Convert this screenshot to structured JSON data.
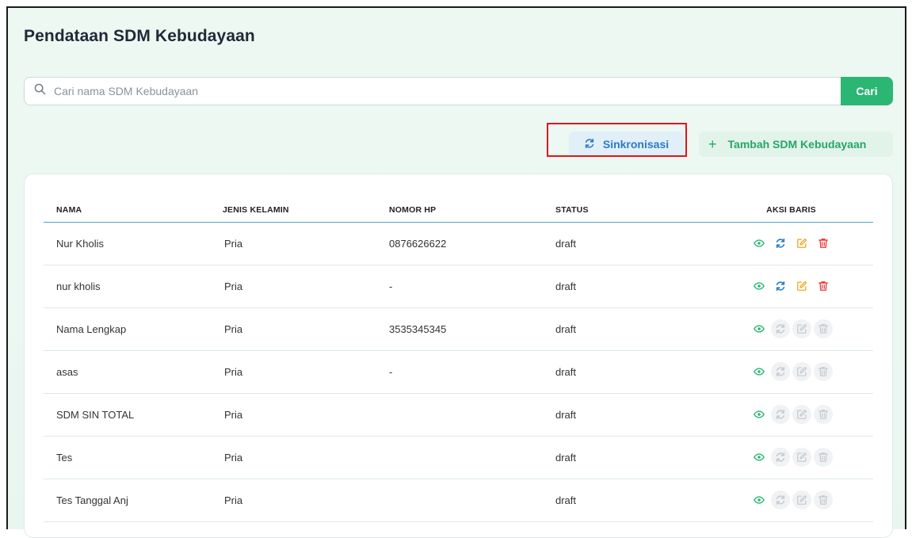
{
  "page": {
    "title": "Pendataan SDM Kebudayaan"
  },
  "search": {
    "placeholder": "Cari nama SDM Kebudayaan",
    "value": "",
    "button_label": "Cari",
    "icon": "search-icon"
  },
  "toolbar": {
    "sync_label": "Sinkronisasi",
    "sync_icon": "sync-icon",
    "add_label": "Tambah SDM Kebudayaan",
    "add_icon": "plus-icon"
  },
  "colors": {
    "accent": "#2bb673",
    "sync": "#2b7bc4",
    "edit": "#f5a623",
    "delete": "#e53935",
    "highlight": "#e0141e"
  },
  "table": {
    "columns": [
      "NAMA",
      "JENIS KELAMIN",
      "NOMOR HP",
      "STATUS",
      "AKSI BARIS"
    ],
    "rows": [
      {
        "nama": "Nur Kholis",
        "jenis_kelamin": "Pria",
        "nomor_hp": "0876626622",
        "status": "draft",
        "actions_enabled": true
      },
      {
        "nama": "nur kholis",
        "jenis_kelamin": "Pria",
        "nomor_hp": "-",
        "status": "draft",
        "actions_enabled": true
      },
      {
        "nama": "Nama Lengkap",
        "jenis_kelamin": "Pria",
        "nomor_hp": "3535345345",
        "status": "draft",
        "actions_enabled": false
      },
      {
        "nama": "asas",
        "jenis_kelamin": "Pria",
        "nomor_hp": "-",
        "status": "draft",
        "actions_enabled": false
      },
      {
        "nama": "SDM SIN TOTAL",
        "jenis_kelamin": "Pria",
        "nomor_hp": "",
        "status": "draft",
        "actions_enabled": false
      },
      {
        "nama": "Tes",
        "jenis_kelamin": "Pria",
        "nomor_hp": "",
        "status": "draft",
        "actions_enabled": false
      },
      {
        "nama": "Tes Tanggal Anj",
        "jenis_kelamin": "Pria",
        "nomor_hp": "",
        "status": "draft",
        "actions_enabled": false
      }
    ],
    "action_icons": [
      "view-icon",
      "sync-icon",
      "edit-icon",
      "delete-icon"
    ]
  }
}
